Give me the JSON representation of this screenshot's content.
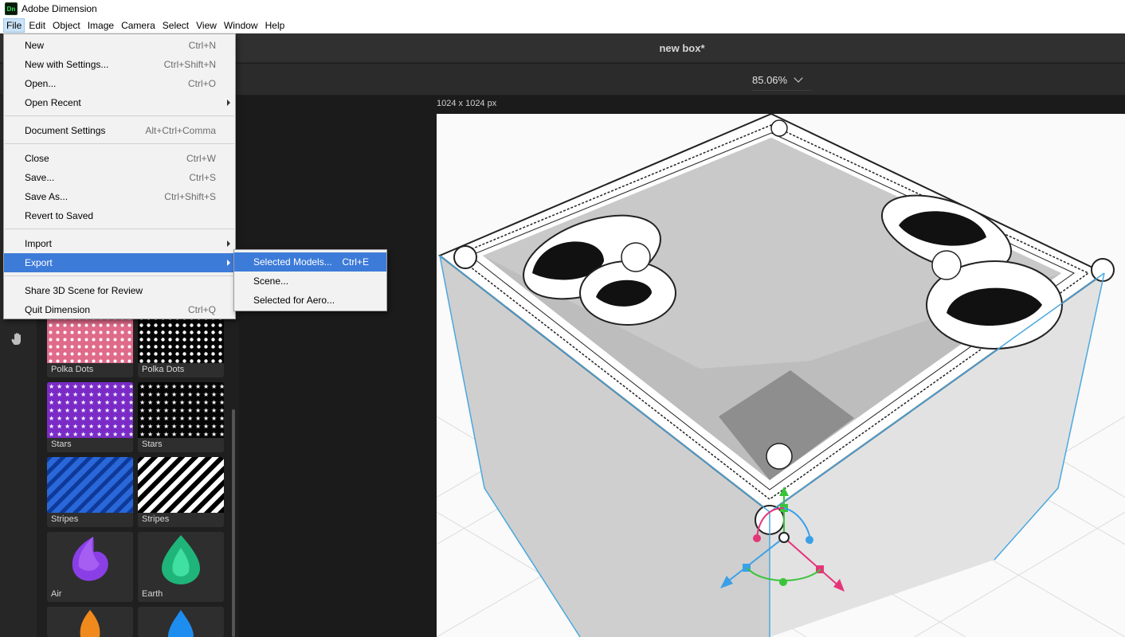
{
  "app": {
    "title": "Adobe Dimension",
    "logo": "Dn"
  },
  "menubar": [
    "File",
    "Edit",
    "Object",
    "Image",
    "Camera",
    "Select",
    "View",
    "Window",
    "Help"
  ],
  "document": {
    "title": "new box*",
    "zoom": "85.06%",
    "canvas_size": "1024 x 1024 px"
  },
  "file_menu": {
    "new": {
      "label": "New",
      "shortcut": "Ctrl+N"
    },
    "new_settings": {
      "label": "New with Settings...",
      "shortcut": "Ctrl+Shift+N"
    },
    "open": {
      "label": "Open...",
      "shortcut": "Ctrl+O"
    },
    "open_recent": {
      "label": "Open Recent"
    },
    "doc_settings": {
      "label": "Document Settings",
      "shortcut": "Alt+Ctrl+Comma"
    },
    "close": {
      "label": "Close",
      "shortcut": "Ctrl+W"
    },
    "save": {
      "label": "Save...",
      "shortcut": "Ctrl+S"
    },
    "save_as": {
      "label": "Save As...",
      "shortcut": "Ctrl+Shift+S"
    },
    "revert": {
      "label": "Revert to Saved"
    },
    "import": {
      "label": "Import"
    },
    "export": {
      "label": "Export"
    },
    "share": {
      "label": "Share 3D Scene for Review"
    },
    "quit": {
      "label": "Quit Dimension",
      "shortcut": "Ctrl+Q"
    }
  },
  "export_submenu": {
    "selected_models": {
      "label": "Selected Models...",
      "shortcut": "Ctrl+E"
    },
    "scene": {
      "label": "Scene..."
    },
    "selected_aero": {
      "label": "Selected for Aero..."
    }
  },
  "assets": {
    "polka1": "Polka Dots",
    "polka2": "Polka Dots",
    "stars1": "Stars",
    "stars2": "Stars",
    "stripes1": "Stripes",
    "stripes2": "Stripes",
    "air": "Air",
    "earth": "Earth"
  },
  "colors": {
    "accent": "#3d7bd9",
    "gizmo_green": "#3bc33b",
    "gizmo_pink": "#e5357a",
    "gizmo_blue": "#39a0e8",
    "selection": "#4aa8e0"
  }
}
